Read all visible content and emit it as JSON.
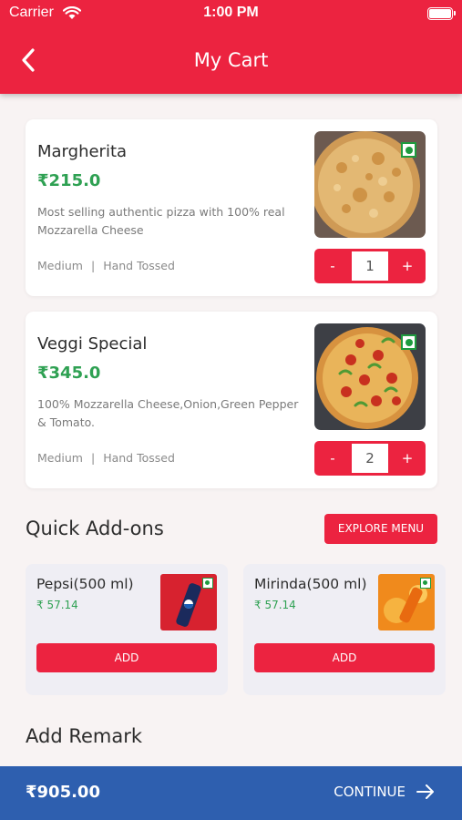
{
  "status_bar": {
    "carrier": "Carrier",
    "time": "1:00 PM"
  },
  "header": {
    "title": "My Cart",
    "back_icon": "chevron-left-icon"
  },
  "cart_items": [
    {
      "name": "Margherita",
      "price": "₹215.0",
      "description": "Most selling authentic pizza with 100% real Mozzarella Cheese",
      "size": "Medium",
      "crust": "Hand Tossed",
      "quantity": "1",
      "minus": "-",
      "plus": "+",
      "veg_icon": "veg-indicator-icon"
    },
    {
      "name": "Veggi Special",
      "price": "₹345.0",
      "description": "100% Mozzarella Cheese,Onion,Green Pepper & Tomato.",
      "size": "Medium",
      "crust": "Hand Tossed",
      "quantity": "2",
      "minus": "-",
      "plus": "+",
      "veg_icon": "veg-indicator-icon"
    }
  ],
  "quick_addons": {
    "title": "Quick Add-ons",
    "explore_label": "EXPLORE MENU",
    "items": [
      {
        "name": "Pepsi(500 ml)",
        "price": "₹ 57.14",
        "add_label": "ADD"
      },
      {
        "name": "Mirinda(500 ml)",
        "price": "₹ 57.14",
        "add_label": "ADD"
      }
    ]
  },
  "remark": {
    "title": "Add Remark"
  },
  "footer": {
    "total": "₹905.00",
    "continue_label": "CONTINUE",
    "arrow_icon": "arrow-right-icon"
  },
  "colors": {
    "primary": "#ec2340",
    "price_green": "#2fa153",
    "footer_blue": "#2e5faf",
    "background": "#f8f3f3"
  }
}
